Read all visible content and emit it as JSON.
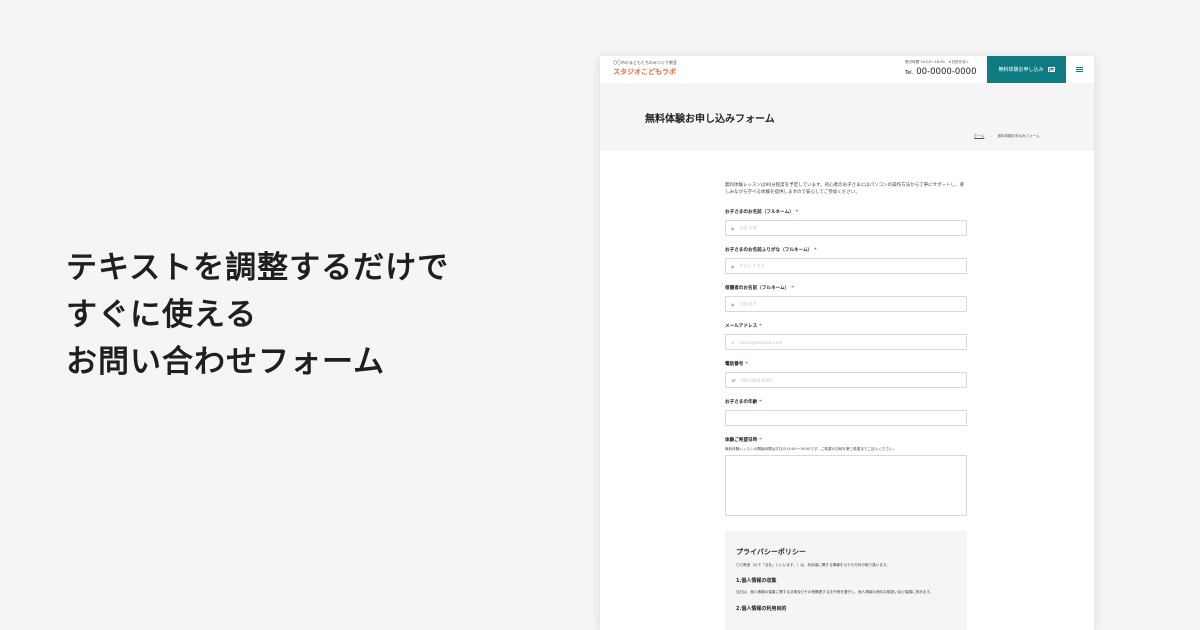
{
  "headline": {
    "line1": "テキストを調整するだけで",
    "line2": "すぐに使える",
    "line3": "お問い合わせフォーム"
  },
  "site": {
    "brand_sub": "〇〇市のまどもたちのみつくり教室",
    "brand_name": "スタジオこどもラボ",
    "hours": "受付時間 10:00〜18:00　※日祝を除く",
    "tel_label": "Tel.",
    "tel": "00-0000-0000",
    "cta_label": "無料体験お申し込み",
    "accent": "#0f7c85",
    "brand_color": "#e8663b"
  },
  "page": {
    "title": "無料体験お申し込みフォーム",
    "breadcrumb_home": "ホーム",
    "breadcrumb_sep": "-",
    "breadcrumb_current": "無料体験お申込みフォーム"
  },
  "form": {
    "intro": "無料体験レッスンは90分程度を予定しています。初心者のお子さまにはパソコンの操作方法から丁寧にサポートし、楽しみながら学べる体験を提供しますので安心してご参加ください。",
    "required_mark": "*",
    "fields": [
      {
        "label": "お子さまのお名前（フルネーム）",
        "placeholder": "山田 太郎",
        "icon": "person-icon"
      },
      {
        "label": "お子さまのお名前ふりがな（フルネーム）",
        "placeholder": "やまだ たろう",
        "icon": "person-icon"
      },
      {
        "label": "保護者のお名前（フルネーム）",
        "placeholder": "山田 花子",
        "icon": "person-icon"
      },
      {
        "label": "メールアドレス",
        "placeholder": "xxxxx@example.com",
        "icon": "mail-icon"
      },
      {
        "label": "電話番号",
        "placeholder": "000-0000-0000",
        "icon": "phone-icon"
      },
      {
        "label": "お子さまの年齢",
        "placeholder": ""
      },
      {
        "label": "体験ご希望日時",
        "help": "無料体験レッスンの開始時間は平日の15:00〜16:00です。ご希望の日時を第三希望までご記入ください。"
      }
    ]
  },
  "policy": {
    "title": "プライバシーポリシー",
    "intro": "〇〇教室（以下「当社」といいます。）は、利用者に関する情報を以下の方針の取り扱います。",
    "sec1_title": "1.個人情報の収集",
    "sec1_body": "当社は、個人情報の保護に関する法律及びその他関連する法令等を遵守し、個人情報の適切な取扱い及び保護に努めます。",
    "sec2_title": "2.個人情報の利用目的"
  }
}
